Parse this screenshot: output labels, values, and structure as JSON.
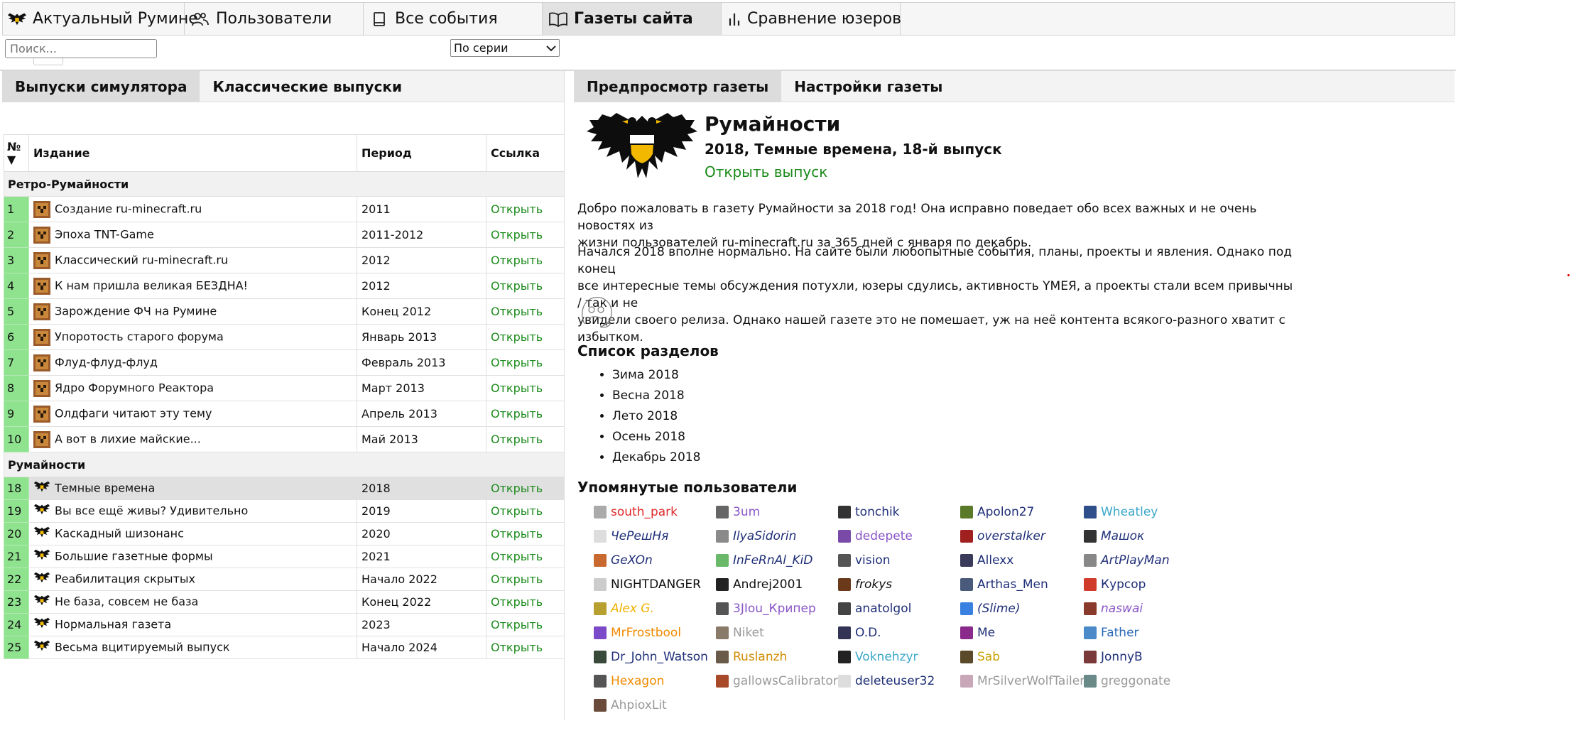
{
  "topnav": {
    "tabs": [
      {
        "label": "Актуальный Румине",
        "icon": "eagle-logo-icon"
      },
      {
        "label": "Пользователи",
        "icon": "users-icon"
      },
      {
        "label": "Все события",
        "icon": "book-icon"
      },
      {
        "label": "Газеты сайта",
        "icon": "open-book-icon",
        "active": true
      },
      {
        "label": "Сравнение юзеров",
        "icon": "bar-chart-icon"
      }
    ],
    "more": "•••"
  },
  "left": {
    "tabs": [
      "Выпуски симулятора",
      "Классические выпуски"
    ],
    "search_placeholder": "Поиск...",
    "series_select": "По серии",
    "columns": {
      "num": "№ ▼",
      "issue": "Издание",
      "period": "Период",
      "link": "Ссылка"
    },
    "groups": [
      {
        "name": "Ретро-Румайности",
        "rows": [
          {
            "num": "1",
            "title": "Создание ru-minecraft.ru",
            "period": "2011",
            "link": "Открыть"
          },
          {
            "num": "2",
            "title": "Эпоха TNT-Game",
            "period": "2011-2012",
            "link": "Открыть"
          },
          {
            "num": "3",
            "title": "Классический ru-minecraft.ru",
            "period": "2012",
            "link": "Открыть"
          },
          {
            "num": "4",
            "title": "К нам пришла великая БЕЗДНА!",
            "period": "2012",
            "link": "Открыть"
          },
          {
            "num": "5",
            "title": "Зарождение ФЧ на Румине",
            "period": "Конец 2012",
            "link": "Открыть"
          },
          {
            "num": "6",
            "title": "Упоротость старого форума",
            "period": "Январь 2013",
            "link": "Открыть"
          },
          {
            "num": "7",
            "title": "Флуд-флуд-флуд",
            "period": "Февраль 2013",
            "link": "Открыть"
          },
          {
            "num": "8",
            "title": "Ядро Форумного Реактора",
            "period": "Март 2013",
            "link": "Открыть"
          },
          {
            "num": "9",
            "title": "Олдфаги читают эту тему",
            "period": "Апрель 2013",
            "link": "Открыть"
          },
          {
            "num": "10",
            "title": "А вот в лихие майские...",
            "period": "Май 2013",
            "link": "Открыть"
          }
        ]
      },
      {
        "name": "Румайности",
        "rows": [
          {
            "num": "18",
            "title": "Темные времена",
            "period": "2018",
            "link": "Открыть",
            "selected": true
          },
          {
            "num": "19",
            "title": "Вы все ещё живы? Удивительно",
            "period": "2019",
            "link": "Открыть"
          },
          {
            "num": "20",
            "title": "Каскадный шизонанс",
            "period": "2020",
            "link": "Открыть"
          },
          {
            "num": "21",
            "title": "Большие газетные формы",
            "period": "2021",
            "link": "Открыть"
          },
          {
            "num": "22",
            "title": "Реабилитация скрытых",
            "period": "Начало 2022",
            "link": "Открыть"
          },
          {
            "num": "23",
            "title": "Не база, совсем не база",
            "period": "Конец 2022",
            "link": "Открыть"
          },
          {
            "num": "24",
            "title": "Нормальная газета",
            "period": "2023",
            "link": "Открыть"
          },
          {
            "num": "25",
            "title": "Весьма вцитируемый выпуск",
            "period": "Начало 2024",
            "link": "Открыть"
          }
        ]
      }
    ]
  },
  "right": {
    "tabs": [
      "Предпросмотр газеты",
      "Настройки газеты"
    ],
    "title": "Румайности",
    "subtitle": "2018, Темные времена, 18-й выпуск",
    "open_link": "Открыть выпуск",
    "para1_line1": "Добро пожаловать в газету Румайности за 2018 год! Она исправно поведает обо всех важных и не очень новостях из",
    "para1_line2": "жизни пользователей ru-minecraft.ru за 365 дней с января по декабрь.",
    "para2_line1": "Начался 2018 вполне нормально. На сайте были любопытные события, планы, проекты и явления. Однако под конец",
    "para2_line2": "все интересные темы обсуждения потухли, юзеры сдулись, активность YMEЯ, а проекты стали всем привычны / так и не",
    "para2_line3": "увидели своего релиза. Однако нашей газете это не помешает, уж на неё контента всякого-разного хватит с избытком.",
    "sections_title": "Список разделов",
    "sections": [
      "Зима 2018",
      "Весна 2018",
      "Лето 2018",
      "Осень 2018",
      "Декабрь 2018"
    ],
    "users_title": "Упомянутые пользователи",
    "users": [
      {
        "name": "south_park",
        "color": "#e0282a",
        "italic": false,
        "av": "#aaaaaa"
      },
      {
        "name": "3um",
        "color": "#8a55c8",
        "italic": false,
        "av": "#666666"
      },
      {
        "name": "tonchik",
        "color": "#1f2f78",
        "italic": false,
        "av": "#333333"
      },
      {
        "name": "Apolon27",
        "color": "#1f2f78",
        "italic": false,
        "av": "#5a7a2a"
      },
      {
        "name": "Wheatley",
        "color": "#3aa7c8",
        "italic": false,
        "av": "#2f4f8a"
      },
      {
        "name": "ЧеРешНя",
        "color": "#1f2f78",
        "italic": true,
        "av": "#dddddd"
      },
      {
        "name": "IlyaSidorin",
        "color": "#1f2f78",
        "italic": true,
        "av": "#8a8a8a"
      },
      {
        "name": "dedepete",
        "color": "#8a55c8",
        "italic": false,
        "av": "#7a4aa8"
      },
      {
        "name": "overstalker",
        "color": "#1f2f78",
        "italic": true,
        "av": "#a02020"
      },
      {
        "name": "Машок",
        "color": "#1f2f78",
        "italic": true,
        "av": "#333333"
      },
      {
        "name": "GeXOn",
        "color": "#1f2f78",
        "italic": true,
        "av": "#c86a30"
      },
      {
        "name": "InFeRnAl_KiD",
        "color": "#1f2f78",
        "italic": true,
        "av": "#6ab86a"
      },
      {
        "name": "vision",
        "color": "#1f2f78",
        "italic": false,
        "av": "#555555"
      },
      {
        "name": "Allexx",
        "color": "#1f2f78",
        "italic": false,
        "av": "#3a3a5a"
      },
      {
        "name": "ArtPlayMan",
        "color": "#1f2f78",
        "italic": true,
        "av": "#888888"
      },
      {
        "name": "NIGHTDANGER",
        "color": "#111111",
        "italic": false,
        "av": "#cccccc"
      },
      {
        "name": "Andrej2001",
        "color": "#111111",
        "italic": false,
        "av": "#222222"
      },
      {
        "name": "frokys",
        "color": "#111111",
        "italic": true,
        "av": "#6a3a1a"
      },
      {
        "name": "Arthas_Men",
        "color": "#1f2f78",
        "italic": false,
        "av": "#4a5a7a"
      },
      {
        "name": "Курсор",
        "color": "#1f2f78",
        "italic": false,
        "av": "#d03a2a"
      },
      {
        "name": "Alex G.",
        "color": "#f0b000",
        "italic": true,
        "av": "#b8a030"
      },
      {
        "name": "3JIou_Крипер",
        "color": "#8a55c8",
        "italic": false,
        "av": "#555555"
      },
      {
        "name": "anatolgol",
        "color": "#1f2f78",
        "italic": false,
        "av": "#444444"
      },
      {
        "name": "(Slime)",
        "color": "#1f2f78",
        "italic": true,
        "av": "#3a80e0"
      },
      {
        "name": "naswai",
        "color": "#8a55c8",
        "italic": true,
        "av": "#8a3a2a"
      },
      {
        "name": "MrFrostbool",
        "color": "#f08a00",
        "italic": false,
        "av": "#7a4ac8"
      },
      {
        "name": "Niket",
        "color": "#999999",
        "italic": false,
        "av": "#8a7a6a"
      },
      {
        "name": "O.D.",
        "color": "#1f2f78",
        "italic": false,
        "av": "#333355"
      },
      {
        "name": "Me",
        "color": "#1f2f78",
        "italic": false,
        "av": "#8a2a8a"
      },
      {
        "name": "Father",
        "color": "#2a6ab8",
        "italic": false,
        "av": "#4a8ac8"
      },
      {
        "name": "Dr_John_Watson",
        "color": "#1f2f78",
        "italic": false,
        "av": "#3a4a3a"
      },
      {
        "name": "Ruslanzh",
        "color": "#d08a00",
        "italic": false,
        "av": "#6a5a4a"
      },
      {
        "name": "Voknehzyr",
        "color": "#3aa7c8",
        "italic": false,
        "av": "#222222"
      },
      {
        "name": "Sab",
        "color": "#c8a000",
        "italic": false,
        "av": "#5a4a2a"
      },
      {
        "name": "JonnyB",
        "color": "#1f2f78",
        "italic": false,
        "av": "#7a3a3a"
      },
      {
        "name": "Hexagon",
        "color": "#f08a00",
        "italic": false,
        "av": "#555555"
      },
      {
        "name": "gallowsCalibrator",
        "color": "#999999",
        "italic": false,
        "av": "#a84a2a"
      },
      {
        "name": "deleteuser32",
        "color": "#1f2f78",
        "italic": false,
        "av": "#dddddd"
      },
      {
        "name": "MrSilverWolfTailer",
        "color": "#999999",
        "italic": false,
        "av": "#c8a8b8"
      },
      {
        "name": "greggonate",
        "color": "#999999",
        "italic": false,
        "av": "#6a8a8a"
      },
      {
        "name": "AhpioxLit",
        "color": "#999999",
        "italic": false,
        "av": "#6a4a3a"
      }
    ]
  }
}
